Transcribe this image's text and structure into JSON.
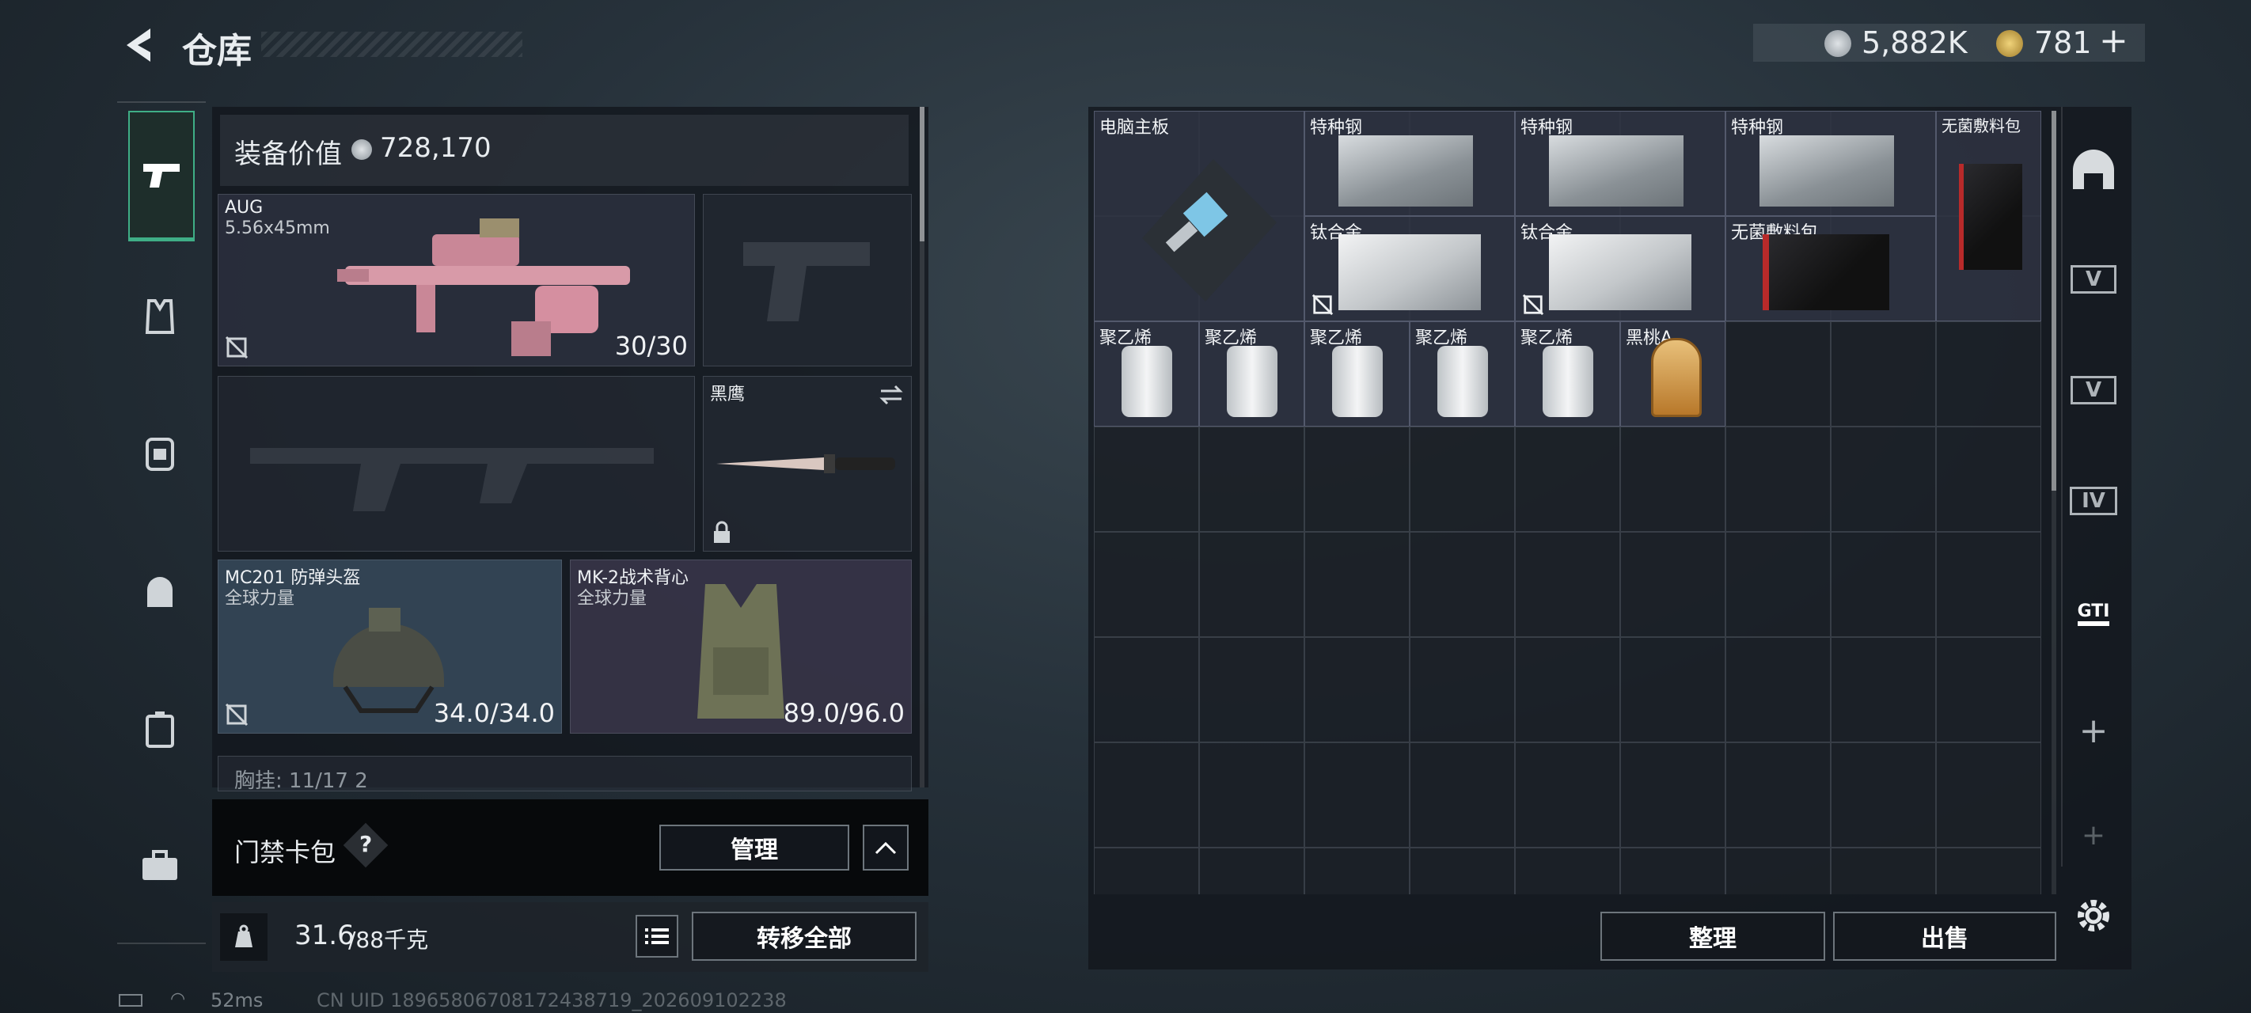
{
  "header": {
    "title": "仓库",
    "currency1_value": "5,882K",
    "currency2_value": "781",
    "currency2_plus": "+"
  },
  "loadout": {
    "value_label": "装备价值",
    "value_amount": "728,170",
    "primary": {
      "name": "AUG",
      "caliber": "5.56x45mm",
      "ammo": "30/30"
    },
    "melee": {
      "name": "黑鹰"
    },
    "helmet": {
      "name": "MC201 防弹头盔",
      "brand": "全球力量",
      "durability": "34.0/34.0"
    },
    "vest": {
      "name": "MK-2战术背心",
      "brand": "全球力量",
      "durability": "89.0/96.0"
    },
    "chest_rig_partial": "胸挂: 11/17 2",
    "keycard": {
      "label": "门禁卡包",
      "help": "?",
      "manage": "管理"
    },
    "weight": {
      "current": "31.6",
      "max": "/88千克"
    },
    "transfer_all": "转移全部"
  },
  "stash": {
    "items": [
      {
        "label": "电脑主板"
      },
      {
        "label": "特种钢"
      },
      {
        "label": "特种钢"
      },
      {
        "label": "特种钢"
      },
      {
        "label": "无菌敷料包"
      },
      {
        "label": "钛合金"
      },
      {
        "label": "钛合金"
      },
      {
        "label": "无菌敷料包"
      },
      {
        "label": "聚乙烯"
      },
      {
        "label": "聚乙烯"
      },
      {
        "label": "聚乙烯"
      },
      {
        "label": "聚乙烯"
      },
      {
        "label": "聚乙烯"
      },
      {
        "label": "黑桃A"
      }
    ],
    "organize": "整理",
    "sell": "出售",
    "tabs": [
      "V",
      "V",
      "IV",
      "GTI"
    ],
    "add": "+"
  },
  "status": {
    "ping": "52ms",
    "uid": "CN UID 18965806708172438719_202609102238"
  },
  "colors": {
    "accent_green": "#3fae86",
    "item_bg": "#2e3242",
    "panel": "#12161c"
  },
  "icons": [
    "back-arrow-icon",
    "silver-coin-icon",
    "gold-coin-icon",
    "pistol-icon",
    "vest-icon",
    "backpack-icon",
    "helmet-bag-icon",
    "case-icon",
    "toolbox-icon",
    "weight-icon",
    "list-icon",
    "chevron-up-icon",
    "swap-icon",
    "lock-icon",
    "no-insure-icon",
    "gear-icon",
    "plus-icon",
    "stash-dome-icon"
  ]
}
